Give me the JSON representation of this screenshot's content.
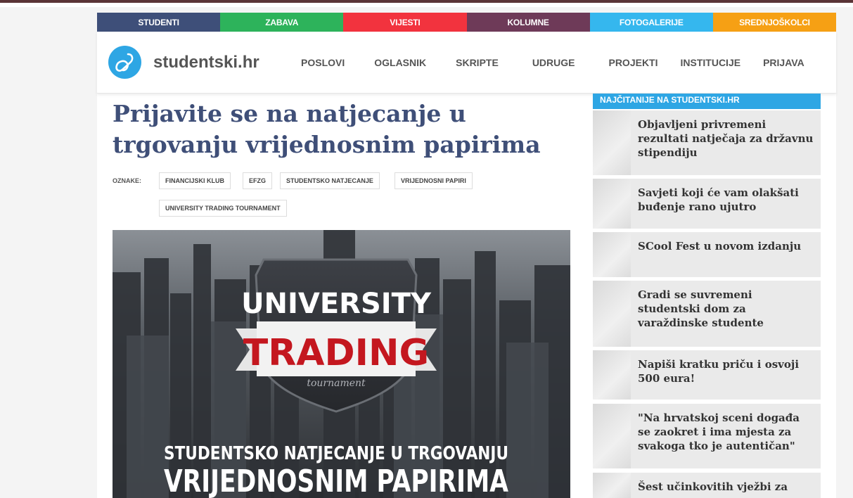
{
  "categories": [
    {
      "label": "STUDENTI",
      "color": "#3e4f79"
    },
    {
      "label": "ZABAVA",
      "color": "#2db35b"
    },
    {
      "label": "VIJESTI",
      "color": "#f2333e"
    },
    {
      "label": "KOLUMNE",
      "color": "#6e3a58"
    },
    {
      "label": "FOTOGALERIJE",
      "color": "#35b7ee"
    },
    {
      "label": "SREDNJOŠKOLCI",
      "color": "#f6a014"
    }
  ],
  "header": {
    "brand": "studentski.hr",
    "nav": [
      "POSLOVI",
      "OGLASNIK",
      "SKRIPTE",
      "UDRUGE",
      "PROJEKTI",
      "INSTITUCIJE",
      "PRIJAVA"
    ]
  },
  "article": {
    "title": "Prijavite se na natjecanje u trgovanju vrijednosnim papirima",
    "tags_label": "OZNAKE:",
    "tags": [
      "FINANCIJSKI KLUB",
      "EFZG",
      "STUDENTSKO NATJECANJE",
      "VRIJEDNOSNI PAPIRI",
      "UNIVERSITY TRADING TOURNAMENT"
    ],
    "hero": {
      "line1": "UNIVERSITY",
      "line2": "TRADING",
      "line3": "tournament",
      "caption1": "STUDENTSKO NATJECANJE U TRGOVANJU",
      "caption2": "VRIJEDNOSNIM PAPIRIMA"
    }
  },
  "sidebar": {
    "heading": "NAJČITANIJE NA STUDENTSKI.HR",
    "items": [
      "Objavljeni privremeni rezultati natječaja za državnu stipendiju",
      "Savjeti koji će vam olakšati buđenje rano ujutro",
      "SCool Fest u novom izdanju",
      "Gradi se suvremeni studentski dom za varaždinske studente",
      "Napiši kratku priču i osvoji 500 eura!",
      "\"Na hrvatskoj sceni događa se zaokret i ima mjesta za svakoga tko je autentičan\"",
      "Šest učinkovitih vježbi za"
    ]
  }
}
